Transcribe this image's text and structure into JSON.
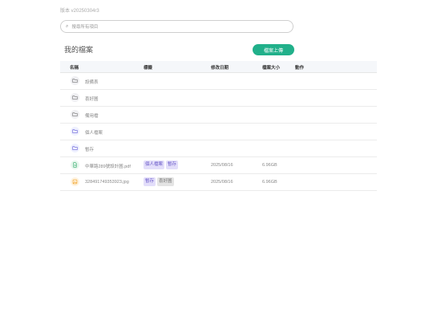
{
  "version": "版本 v20250304r3",
  "search": {
    "placeholder": "搜尋所有項目"
  },
  "title": "我的檔案",
  "upload_label": "檔案上傳",
  "columns": {
    "name": "名稱",
    "tags": "標籤",
    "date": "修改日期",
    "size": "檔案大小",
    "action": "動作"
  },
  "rows": [
    {
      "icon": "folder-icon",
      "name": "設備表"
    },
    {
      "icon": "folder-icon",
      "name": "喜好圖"
    },
    {
      "icon": "folder-icon",
      "name": "備用檔"
    },
    {
      "icon": "folder-icon",
      "name": "個人檔案"
    },
    {
      "icon": "folder-icon",
      "name": "暫存"
    },
    {
      "icon": "pdf-file-icon",
      "name": "中華路289號設計圖.pdf",
      "tags": [
        "個人檔案",
        "暫存"
      ],
      "date": "2025/08/16",
      "size": "6.96GB"
    },
    {
      "icon": "image-file-icon",
      "name": "328491749353923.jpg",
      "tags": [
        "暫存",
        "喜好圖"
      ],
      "date": "2025/08/16",
      "size": "6.96GB"
    }
  ],
  "colors": {
    "accent": "#21b08a",
    "tag_purple": "#e3defa",
    "tag_gray": "#e4e4e4"
  }
}
